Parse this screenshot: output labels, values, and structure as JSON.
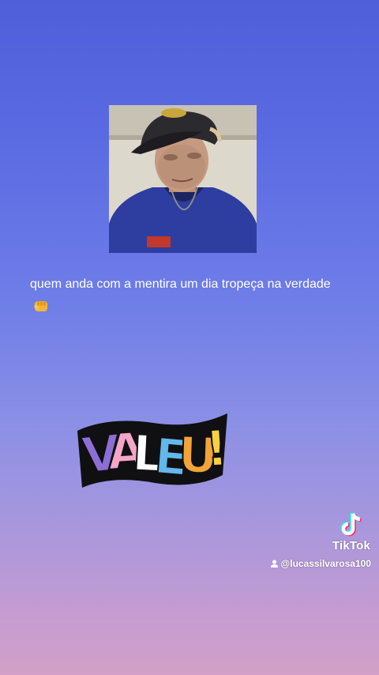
{
  "post": {
    "caption": "quem anda com a mentira um dia tropeça na verdade",
    "caption_emoji": "fist-bump-emoji",
    "photo_icon": "profile-photo"
  },
  "sticker": {
    "text": "VALEU!",
    "letters": [
      "V",
      "A",
      "L",
      "E",
      "U",
      "!"
    ],
    "letter_colors": [
      "#8b6fd6",
      "#f3a6c8",
      "#ffffff",
      "#62b8ea",
      "#f2a33a",
      "#f6d23f"
    ]
  },
  "watermark": {
    "brand": "TikTok",
    "username": "@lucassilvarosa100",
    "logo_icon": "tiktok-logo-icon",
    "user_icon": "user-icon"
  },
  "colors": {
    "background_top": "#4f5fd9",
    "background_bottom": "#d2a0c8",
    "caption_text": "#ffffff"
  }
}
